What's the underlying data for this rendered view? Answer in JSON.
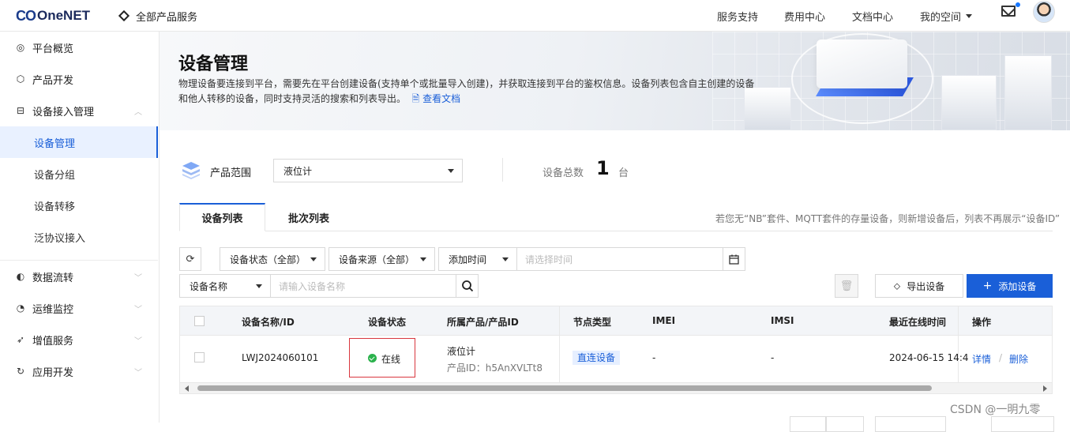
{
  "topbar": {
    "logo_mark": "CO",
    "logo_text": "OneNET",
    "all_services": "全部产品服务",
    "nav": [
      "服务支持",
      "费用中心",
      "文档中心"
    ],
    "my_space": "我的空间"
  },
  "sidebar": {
    "items": [
      {
        "label": "平台概览",
        "icon": "overview-icon"
      },
      {
        "label": "产品开发",
        "icon": "cube-icon"
      },
      {
        "label": "设备接入管理",
        "icon": "device-icon"
      },
      {
        "label": "数据流转",
        "icon": "flow-icon"
      },
      {
        "label": "运维监控",
        "icon": "monitor-icon"
      },
      {
        "label": "增值服务",
        "icon": "send-icon"
      },
      {
        "label": "应用开发",
        "icon": "app-icon"
      }
    ],
    "subitems": [
      "设备管理",
      "设备分组",
      "设备转移",
      "泛协议接入"
    ]
  },
  "banner": {
    "title": "设备管理",
    "desc_line1": "物理设备要连接到平台，需要先在平台创建设备(支持单个或批量导入创建)，并获取连接到平台的鉴权信息。设备列表包含自主创建的设备",
    "desc_line2": "和他人转移的设备，同时支持灵活的搜索和列表导出。",
    "doc_link": "查看文档"
  },
  "scope": {
    "label": "产品范围",
    "selected": "液位计",
    "total_label": "设备总数",
    "total_value": "1",
    "total_unit": "台"
  },
  "tabs": {
    "items": [
      "设备列表",
      "批次列表"
    ],
    "note": "若您无“NB”套件、MQTT套件的存量设备，则新增设备后，列表不再展示“设备ID”"
  },
  "filters": {
    "status": "设备状态（全部）",
    "source": "设备来源（全部）",
    "time_field": "添加时间",
    "time_placeholder": "请选择时间",
    "name_field": "设备名称",
    "name_placeholder": "请输入设备名称",
    "export": "导出设备",
    "add": "添加设备"
  },
  "table": {
    "headers": [
      "设备名称/ID",
      "设备状态",
      "所属产品/产品ID",
      "节点类型",
      "IMEI",
      "IMSI",
      "最近在线时间",
      "操作"
    ],
    "row": {
      "name": "LWJ2024060101",
      "status": "在线",
      "product": "液位计",
      "product_id": "产品ID：h5AnXVLTt8",
      "node_type": "直连设备",
      "imei": "-",
      "imsi": "-",
      "last_online": "2024-06-15 14:4",
      "detail": "详情",
      "sep": "/",
      "delete": "删除"
    }
  },
  "watermark": "CSDN @一明九零",
  "colors": {
    "primary": "#1a5fd8",
    "online": "#2bb24c",
    "highlight": "#d9363e"
  }
}
